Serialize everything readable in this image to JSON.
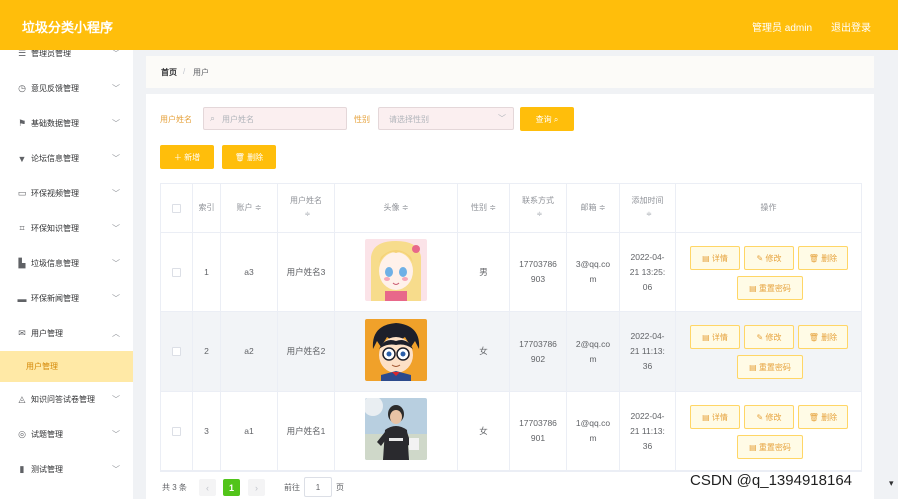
{
  "header": {
    "title": "垃圾分类小程序",
    "user": "管理员 admin",
    "logout": "退出登录"
  },
  "sidebar": {
    "items": [
      {
        "label": "管理员管理",
        "icon": "list-icon",
        "glyph": "☰",
        "arrow": "﹀"
      },
      {
        "label": "意见反馈管理",
        "icon": "clock-icon",
        "glyph": "◷",
        "arrow": "﹀"
      },
      {
        "label": "基础数据管理",
        "icon": "flag-icon",
        "glyph": "⚑",
        "arrow": "﹀"
      },
      {
        "label": "论坛信息管理",
        "icon": "cup-icon",
        "glyph": "▼",
        "arrow": "﹀"
      },
      {
        "label": "环保视频管理",
        "icon": "chat-icon",
        "glyph": "▭",
        "arrow": "﹀"
      },
      {
        "label": "环保知识管理",
        "icon": "crop-icon",
        "glyph": "⌗",
        "arrow": "﹀"
      },
      {
        "label": "垃圾信息管理",
        "icon": "chart-icon",
        "glyph": "▙",
        "arrow": "﹀"
      },
      {
        "label": "环保新闻管理",
        "icon": "monitor-icon",
        "glyph": "▬",
        "arrow": "﹀"
      },
      {
        "label": "用户管理",
        "icon": "mail-icon",
        "glyph": "✉",
        "arrow": "︿"
      },
      {
        "label": "知识问答试卷管理",
        "icon": "bell-off-icon",
        "glyph": "◬",
        "arrow": "﹀"
      },
      {
        "label": "试题管理",
        "icon": "compass-icon",
        "glyph": "◎",
        "arrow": "﹀"
      },
      {
        "label": "测试管理",
        "icon": "bar-chart-icon",
        "glyph": "▮",
        "arrow": "﹀"
      }
    ],
    "sub_item": "用户管理"
  },
  "breadcrumb": {
    "home": "首页",
    "sep": "/",
    "current": "用户"
  },
  "search": {
    "name_label": "用户姓名",
    "name_placeholder": "用户姓名",
    "gender_label": "性别",
    "gender_placeholder": "请选择性别",
    "query_button": "查询 ⌕",
    "add_button": "＋ 新增",
    "delete_button": "🗑 删除"
  },
  "table": {
    "headers": [
      "索引",
      "账户 ≑",
      "用户姓名 ≑",
      "头像 ≑",
      "性别 ≑",
      "联系方式 ≑",
      "邮箱 ≑",
      "添加时间 ≑",
      "操作"
    ],
    "headers_lines": {
      "h3": [
        "用户姓名",
        "≑"
      ],
      "h6": [
        "联系方式",
        "≑"
      ],
      "h8": [
        "添加时间",
        "≑"
      ]
    },
    "rows": [
      {
        "index": "1",
        "account": "a3",
        "name": "用户姓名3",
        "gender": "男",
        "phone": [
          "17703786",
          "903"
        ],
        "email": [
          "3@qq.co",
          "m"
        ],
        "time": [
          "2022-04-",
          "21 13:25:",
          "06"
        ]
      },
      {
        "index": "2",
        "account": "a2",
        "name": "用户姓名2",
        "gender": "女",
        "phone": [
          "17703786",
          "902"
        ],
        "email": [
          "2@qq.co",
          "m"
        ],
        "time": [
          "2022-04-",
          "21 11:13:",
          "36"
        ]
      },
      {
        "index": "3",
        "account": "a1",
        "name": "用户姓名1",
        "gender": "女",
        "phone": [
          "17703786",
          "901"
        ],
        "email": [
          "1@qq.co",
          "m"
        ],
        "time": [
          "2022-04-",
          "21 11:13:",
          "36"
        ]
      }
    ],
    "actions": {
      "detail": "▤ 详情",
      "edit": "✎ 修改",
      "delete": "🗑 删除",
      "reset": "▤ 重置密码"
    }
  },
  "pagination": {
    "total": "共 3 条",
    "prev": "‹",
    "current": "1",
    "next": "›",
    "goto": "前往",
    "page_value": "1",
    "page_suffix": "页"
  },
  "watermark": "CSDN @q_1394918164",
  "colors": {
    "accent": "#ffbe0b",
    "active_bg": "#ffe9a6",
    "page_current": "#52c41a"
  }
}
